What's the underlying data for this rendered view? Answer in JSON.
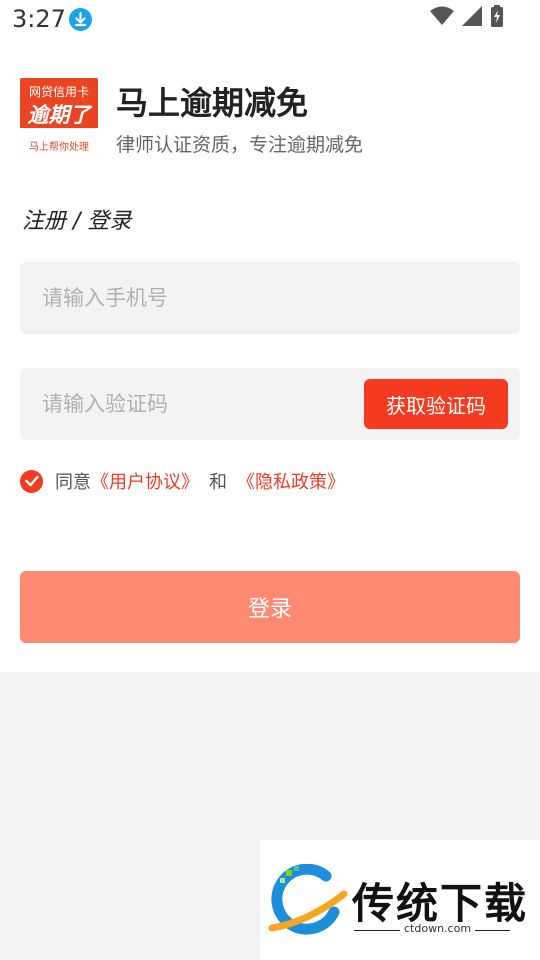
{
  "status_bar": {
    "time": "3:27"
  },
  "brand": {
    "logo_line1": "网贷信用卡",
    "logo_line2": "逾期了",
    "logo_line3": "马上帮你处理",
    "title": "马上逾期减免",
    "subtitle": "律师认证资质，专注逾期减免"
  },
  "form": {
    "section_title": "注册 / 登录",
    "phone_placeholder": "请输入手机号",
    "code_placeholder": "请输入验证码",
    "get_code_label": "获取验证码",
    "agree_prefix": "同意",
    "user_agreement": "《用户协议》",
    "and_text": "和",
    "privacy_policy": "《隐私政策》",
    "agreement_checked": true,
    "login_label": "登录"
  },
  "watermark": {
    "text": "传统下载",
    "domain": "ctdown.com"
  },
  "colors": {
    "accent": "#f23b20",
    "login_button": "#ff8a74",
    "download_badge": "#1ba3e9"
  }
}
